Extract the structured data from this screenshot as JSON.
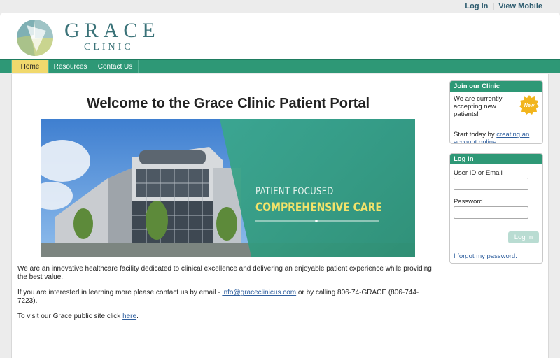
{
  "topbar": {
    "login": "Log In",
    "separator": "|",
    "mobile": "View Mobile"
  },
  "brand": {
    "name": "GRACE",
    "sub": "CLINIC"
  },
  "nav": [
    {
      "label": "Home",
      "active": true
    },
    {
      "label": "Resources",
      "active": false
    },
    {
      "label": "Contact Us",
      "active": false
    }
  ],
  "main": {
    "title": "Welcome to the Grace Clinic Patient Portal",
    "banner_line1": "PATIENT FOCUSED",
    "banner_line2": "COMPREHENSIVE CARE",
    "p1": "We are an innovative healthcare facility dedicated to clinical excellence and delivering an enjoyable patient experience while providing the best value.",
    "p2_before": "If you are interested in learning more please contact us by email - ",
    "p2_email": "info@graceclinicus.com",
    "p2_after": " or by calling 806-74-GRACE (806-744-7223).",
    "p3_before": "To visit our Grace public site click ",
    "p3_link": "here",
    "p3_after": "."
  },
  "join_panel": {
    "title": "Join our Clinic",
    "text1": "We are currently accepting new patients!",
    "badge": "New",
    "text2_before": "Start today by ",
    "text2_link": "creating an account online",
    "text2_after": "."
  },
  "login_panel": {
    "title": "Log in",
    "user_label": "User ID or Email",
    "user_value": "",
    "password_label": "Password",
    "password_value": "",
    "button": "Log In",
    "forgot": "I forgot my password."
  },
  "colors": {
    "brand_green": "#2e9876",
    "active_tab": "#f1d96d",
    "link": "#2f5f9e",
    "badge": "#f2b51d"
  }
}
